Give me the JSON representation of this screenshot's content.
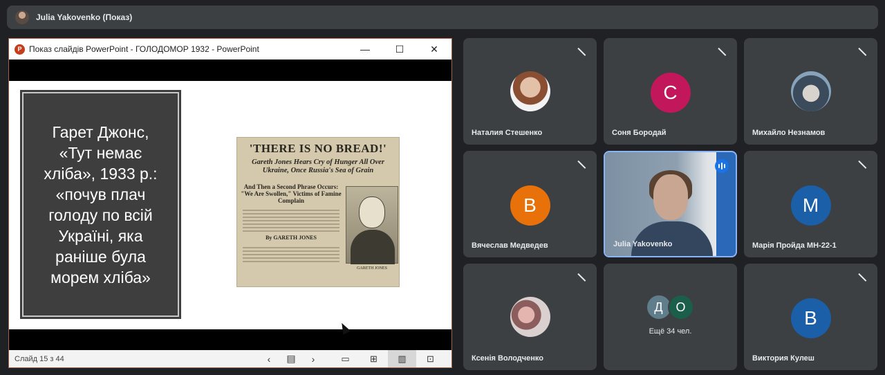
{
  "top_bar": {
    "presenter_name": "Julia Yakovenko (Показ)"
  },
  "ppt_window": {
    "title": "Показ слайдів PowerPoint  -  ГОЛОДОМОР 1932  -  PowerPoint",
    "logo_letter": "P",
    "min_glyph": "—",
    "max_glyph": "☐",
    "close_glyph": "✕",
    "slide_text": "Гарет Джонс, «Тут немає хліба», 1933 р.: «почув плач голоду по всій Україні, яка раніше була морем хліба»",
    "clipping": {
      "headline": "'THERE IS NO BREAD!'",
      "subhead": "Gareth Jones Hears Cry of Hunger All Over Ukraine, Once Russia's Sea of Grain",
      "second_head": "And Then a Second Phrase Occurs: \"We Are Swollen,\" Victims of Famine Complain",
      "byline": "By GARETH JONES",
      "photo_caption": "GARETH JONES"
    },
    "status": {
      "slide_counter": "Слайд 15 з 44",
      "prev_glyph": "‹",
      "notes_glyph": "▤",
      "next_glyph": "›",
      "normal_glyph": "▭",
      "sorter_glyph": "⊞",
      "reading_glyph": "▥",
      "slideshow_glyph": "⊡"
    }
  },
  "participants": [
    {
      "name": "Наталия Стешенко",
      "type": "photo",
      "muted": true
    },
    {
      "name": "Соня Бородай",
      "type": "initial",
      "initial": "С",
      "color": "#c2185b",
      "muted": true
    },
    {
      "name": "Михайло Незнамов",
      "type": "photo",
      "muted": true
    },
    {
      "name": "Вячеслав Медведев",
      "type": "initial",
      "initial": "В",
      "color": "#e8710a",
      "muted": true
    },
    {
      "name": "Julia Yakovenko",
      "type": "video",
      "speaking": true
    },
    {
      "name": "Марія Пройда МН-22-1",
      "type": "initial",
      "initial": "М",
      "color": "#1a5fa8",
      "muted": true
    },
    {
      "name": "Ксенія Володченко",
      "type": "photo",
      "muted": true
    },
    {
      "name": "Ещё 34 чел.",
      "type": "overflow",
      "initials": [
        "Д",
        "О"
      ],
      "colors": [
        "#607d8b",
        "#1b5e4a"
      ]
    },
    {
      "name": "Виктория Кулеш",
      "type": "initial",
      "initial": "В",
      "color": "#1a5fa8",
      "muted": true
    }
  ],
  "mic_glyph": "🎙"
}
